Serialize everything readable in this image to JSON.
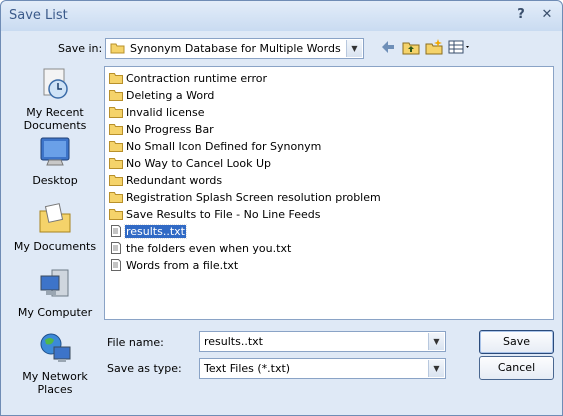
{
  "window": {
    "title": "Save List",
    "help_glyph": "?",
    "close_glyph": "✕"
  },
  "save_in": {
    "label": "Save in:",
    "value": "Synonym Database for Multiple Words"
  },
  "places": [
    {
      "label": "My Recent Documents",
      "icon": "recent-documents-icon"
    },
    {
      "label": "Desktop",
      "icon": "desktop-icon"
    },
    {
      "label": "My Documents",
      "icon": "my-documents-icon"
    },
    {
      "label": "My Computer",
      "icon": "my-computer-icon"
    },
    {
      "label": "My Network Places",
      "icon": "network-places-icon"
    }
  ],
  "files": [
    {
      "name": "Contraction runtime error",
      "type": "folder"
    },
    {
      "name": "Deleting a Word",
      "type": "folder"
    },
    {
      "name": "Invalid license",
      "type": "folder"
    },
    {
      "name": "No Progress Bar",
      "type": "folder"
    },
    {
      "name": "No Small Icon Defined for Synonym",
      "type": "folder"
    },
    {
      "name": "No Way to Cancel Look Up",
      "type": "folder"
    },
    {
      "name": "Redundant words",
      "type": "folder"
    },
    {
      "name": "Registration Splash Screen resolution problem",
      "type": "folder"
    },
    {
      "name": "Save Results to File - No Line Feeds",
      "type": "folder"
    },
    {
      "name": "results..txt",
      "type": "file",
      "selected": true
    },
    {
      "name": "the folders even when you.txt",
      "type": "file"
    },
    {
      "name": "Words from a file.txt",
      "type": "file"
    }
  ],
  "file_name": {
    "label": "File name:",
    "value": "results..txt"
  },
  "save_as_type": {
    "label": "Save as type:",
    "value": "Text Files (*.txt)"
  },
  "buttons": {
    "save": "Save",
    "cancel": "Cancel"
  },
  "colors": {
    "selection": "#316ac5",
    "folder": "#f5d36a"
  }
}
